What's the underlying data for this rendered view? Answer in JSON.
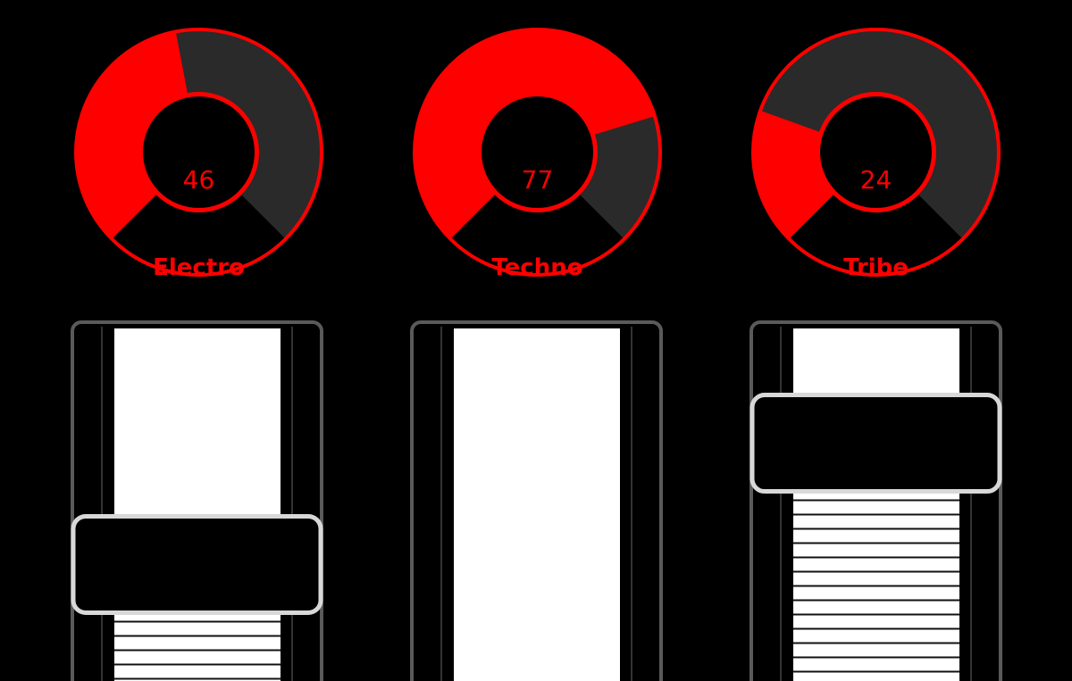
{
  "theme": {
    "accent": "#ff0000",
    "track": "#2a2a2a",
    "background": "#000000",
    "frame": "#5a5a5a",
    "handle_border": "#d8d8d8"
  },
  "knobs": [
    {
      "label": "Electro",
      "value": "46",
      "level": 46
    },
    {
      "label": "Techno",
      "value": "77",
      "level": 77
    },
    {
      "label": "Tribe",
      "value": "24",
      "level": 24
    }
  ],
  "faders": [
    {
      "name": "Electro",
      "level": 0.27
    },
    {
      "name": "Techno",
      "level": 0.0
    },
    {
      "name": "Tribe",
      "level": 0.72
    }
  ]
}
